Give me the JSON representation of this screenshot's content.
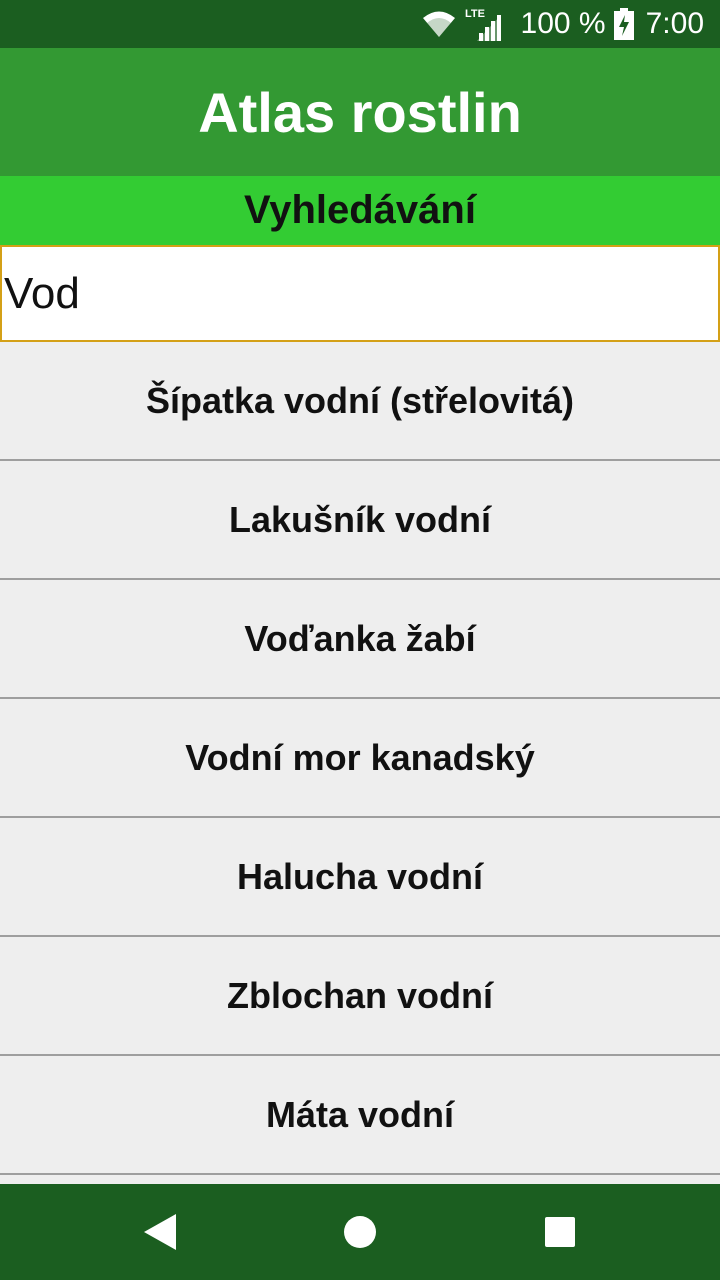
{
  "status_bar": {
    "network_label": "LTE",
    "battery_percent": "100 %",
    "time": "7:00",
    "icons": [
      "wifi-icon",
      "cellular-signal-icon",
      "battery-charging-icon"
    ]
  },
  "app_bar": {
    "title": "Atlas rostlin"
  },
  "section": {
    "title": "Vyhledávání"
  },
  "search": {
    "value": "Vod",
    "placeholder": ""
  },
  "results": [
    "Šípatka vodní (střelovitá)",
    "Lakušník vodní",
    "Voďanka žabí",
    "Vodní mor kanadský",
    "Halucha vodní",
    "Zblochan vodní",
    "Máta vodní",
    ""
  ],
  "nav_bar": {
    "icons": [
      "back-icon",
      "home-icon",
      "recents-icon"
    ]
  },
  "colors": {
    "status_bar": "#1b5e20",
    "app_bar": "#339933",
    "section_header": "#33cc33",
    "list_background": "#eeeeee",
    "divider": "#9e9e9e",
    "input_border": "#d4a017"
  }
}
